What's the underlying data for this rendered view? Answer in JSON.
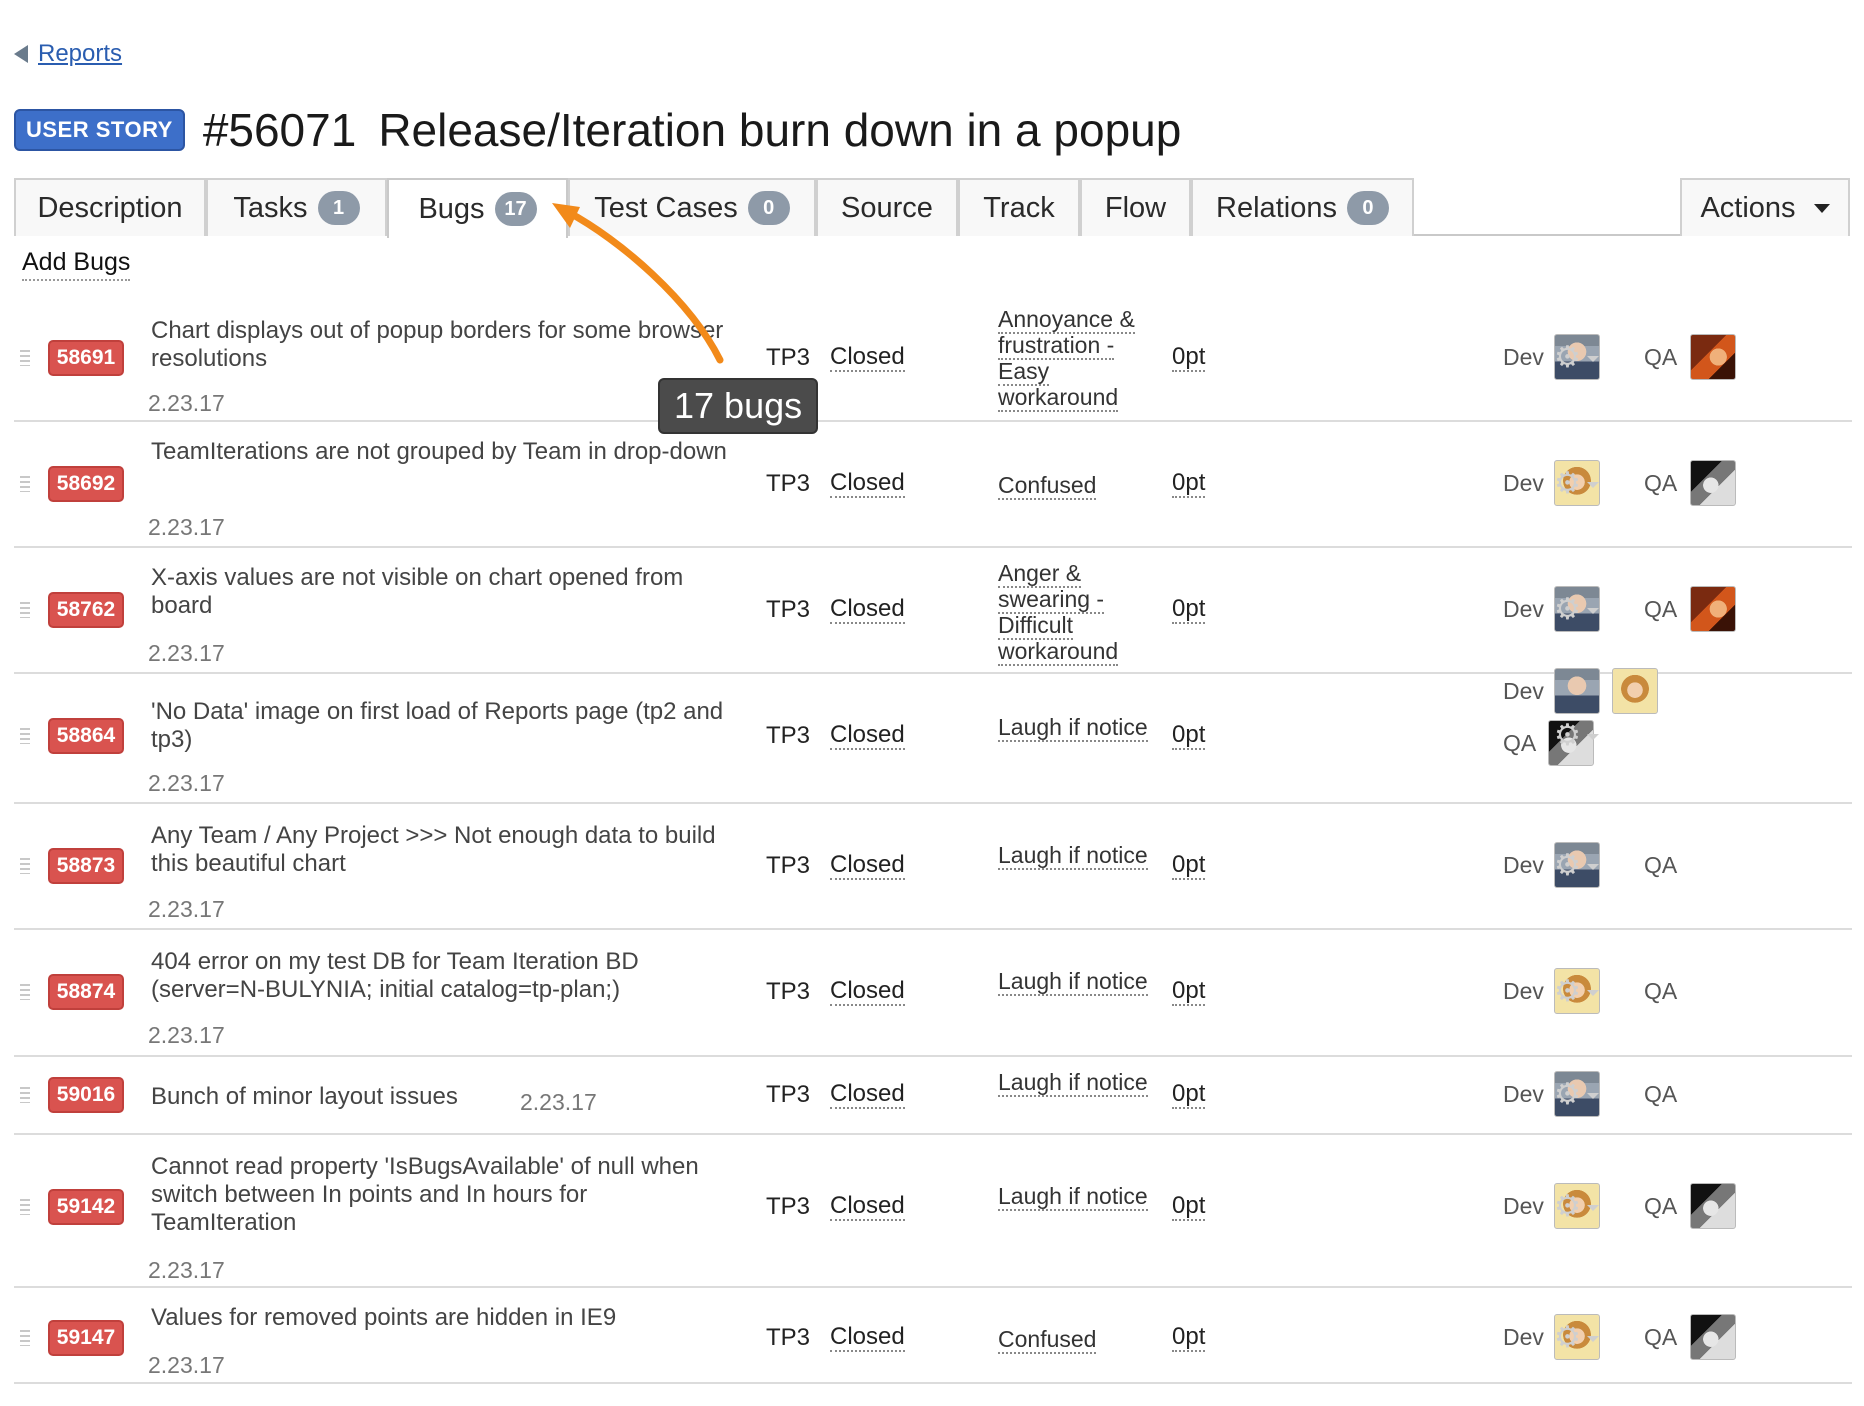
{
  "nav": {
    "back_label": "Reports"
  },
  "story": {
    "badge": "USER STORY",
    "id": "#56071",
    "title": "Release/Iteration burn down in a popup"
  },
  "tabs": [
    {
      "label": "Description",
      "count": null
    },
    {
      "label": "Tasks",
      "count": "1"
    },
    {
      "label": "Bugs",
      "count": "17",
      "active": true
    },
    {
      "label": "Test Cases",
      "count": "0"
    },
    {
      "label": "Source",
      "count": null
    },
    {
      "label": "Track",
      "count": null
    },
    {
      "label": "Flow",
      "count": null
    },
    {
      "label": "Relations",
      "count": "0"
    }
  ],
  "actions_label": "Actions",
  "add_bugs_label": "Add Bugs",
  "callout": {
    "text": "17 bugs",
    "color": "#f28a1a"
  },
  "roles": {
    "dev": "Dev",
    "qa": "QA"
  },
  "bugs": [
    {
      "id": "58691",
      "name": "Chart displays out of popup borders for some browser resolutions",
      "version": "2.23.17",
      "team": "TP3",
      "state": "Closed",
      "severity": "Annoyance & frustration - Easy workaround",
      "effort": "0pt",
      "dev": [
        "man"
      ],
      "qa": [
        "red"
      ]
    },
    {
      "id": "58692",
      "name": "TeamIterations are not grouped by Team in drop-down",
      "version": "2.23.17",
      "team": "TP3",
      "state": "Closed",
      "severity": "Confused",
      "effort": "0pt",
      "dev": [
        "curly"
      ],
      "qa": [
        "bw"
      ]
    },
    {
      "id": "58762",
      "name": "X-axis values are not visible on chart opened from board",
      "version": "2.23.17",
      "team": "TP3",
      "state": "Closed",
      "severity": "Anger & swearing - Difficult workaround",
      "effort": "0pt",
      "dev": [
        "man"
      ],
      "qa": [
        "red"
      ]
    },
    {
      "id": "58864",
      "name": "'No Data' image on first load of Reports page (tp2 and tp3)",
      "version": "2.23.17",
      "team": "TP3",
      "state": "Closed",
      "severity": "Laugh if notice",
      "effort": "0pt",
      "dev": [
        "man",
        "curly"
      ],
      "qa": [
        "bw"
      ]
    },
    {
      "id": "58873",
      "name": "Any Team / Any Project >>> Not enough data to build this beautiful chart",
      "version": "2.23.17",
      "team": "TP3",
      "state": "Closed",
      "severity": "Laugh if notice",
      "effort": "0pt",
      "dev": [
        "man"
      ],
      "qa": []
    },
    {
      "id": "58874",
      "name": "404 error on my test DB for Team Iteration BD (server=N-BULYNIA; initial catalog=tp-plan;)",
      "version": "2.23.17",
      "team": "TP3",
      "state": "Closed",
      "severity": "Laugh if notice",
      "effort": "0pt",
      "dev": [
        "curly"
      ],
      "qa": []
    },
    {
      "id": "59016",
      "name": "Bunch of minor layout issues",
      "version": "2.23.17",
      "team": "TP3",
      "state": "Closed",
      "severity": "Laugh if notice",
      "effort": "0pt",
      "dev": [
        "man"
      ],
      "qa": []
    },
    {
      "id": "59142",
      "name": "Cannot read property 'IsBugsAvailable' of null when switch between In points and In hours for TeamIteration",
      "version": "2.23.17",
      "team": "TP3",
      "state": "Closed",
      "severity": "Laugh if notice",
      "effort": "0pt",
      "dev": [
        "curly"
      ],
      "qa": [
        "bw"
      ]
    },
    {
      "id": "59147",
      "name": "Values for removed points are hidden in IE9",
      "version": "2.23.17",
      "team": "TP3",
      "state": "Closed",
      "severity": "Confused",
      "effort": "0pt",
      "dev": [
        "curly"
      ],
      "qa": [
        "bw"
      ]
    }
  ]
}
